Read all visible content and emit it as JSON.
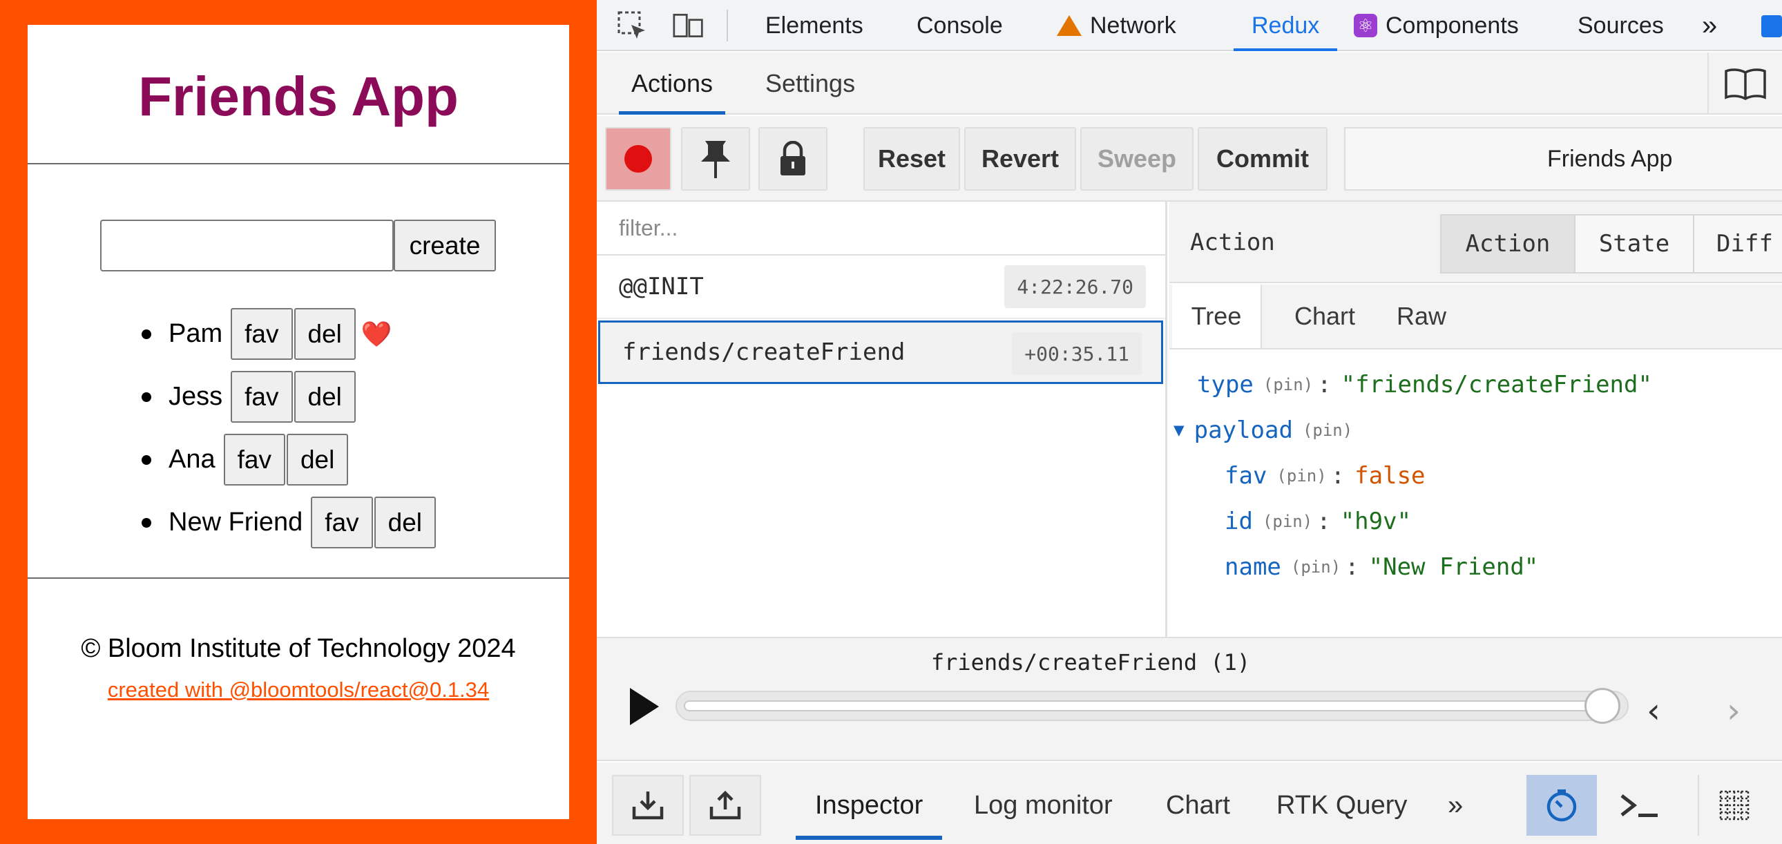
{
  "app": {
    "title": "Friends App",
    "input_value": "",
    "create_label": "create",
    "fav_label": "fav",
    "del_label": "del",
    "friends": [
      {
        "name": "Pam",
        "fav": true
      },
      {
        "name": "Jess",
        "fav": false
      },
      {
        "name": "Ana",
        "fav": false
      },
      {
        "name": "New Friend",
        "fav": false
      }
    ],
    "heart": "❤️",
    "footer_copyright": "© Bloom Institute of Technology 2024",
    "footer_link": "created with @bloomtools/react@0.1.34",
    "colors": {
      "frame": "#ff5000",
      "title": "#8b0b58",
      "link": "#ff5000"
    }
  },
  "devtools": {
    "tabs": {
      "elements": "Elements",
      "console": "Console",
      "network": "Network",
      "redux": "Redux",
      "components": "Components",
      "sources": "Sources",
      "more": "»"
    },
    "active_tab": "Redux",
    "redux": {
      "subtabs": {
        "actions": "Actions",
        "settings": "Settings"
      },
      "toolbar": {
        "reset": "Reset",
        "revert": "Revert",
        "sweep": "Sweep",
        "commit": "Commit",
        "instance": "Friends App"
      },
      "filter_placeholder": "filter...",
      "actions": [
        {
          "name": "@@INIT",
          "time": "4:22:26.70",
          "selected": false
        },
        {
          "name": "friends/createFriend",
          "time": "+00:35.11",
          "selected": true
        }
      ],
      "detail": {
        "header_label": "Action",
        "segments": {
          "action": "Action",
          "state": "State",
          "diff": "Diff"
        },
        "view_tabs": {
          "tree": "Tree",
          "chart": "Chart",
          "raw": "Raw"
        },
        "pin_label": "(pin)",
        "type_key": "type",
        "type_value": "\"friends/createFriend\"",
        "payload_key": "payload",
        "fav_key": "fav",
        "fav_value": "false",
        "id_key": "id",
        "id_value": "\"h9v\"",
        "name_key": "name",
        "name_value": "\"New Friend\""
      },
      "slider": {
        "label": "friends/createFriend (1)",
        "position": 1.0
      },
      "bottom_tabs": {
        "inspector": "Inspector",
        "log_monitor": "Log monitor",
        "chart": "Chart",
        "rtk_query": "RTK Query",
        "more": "»"
      }
    }
  }
}
